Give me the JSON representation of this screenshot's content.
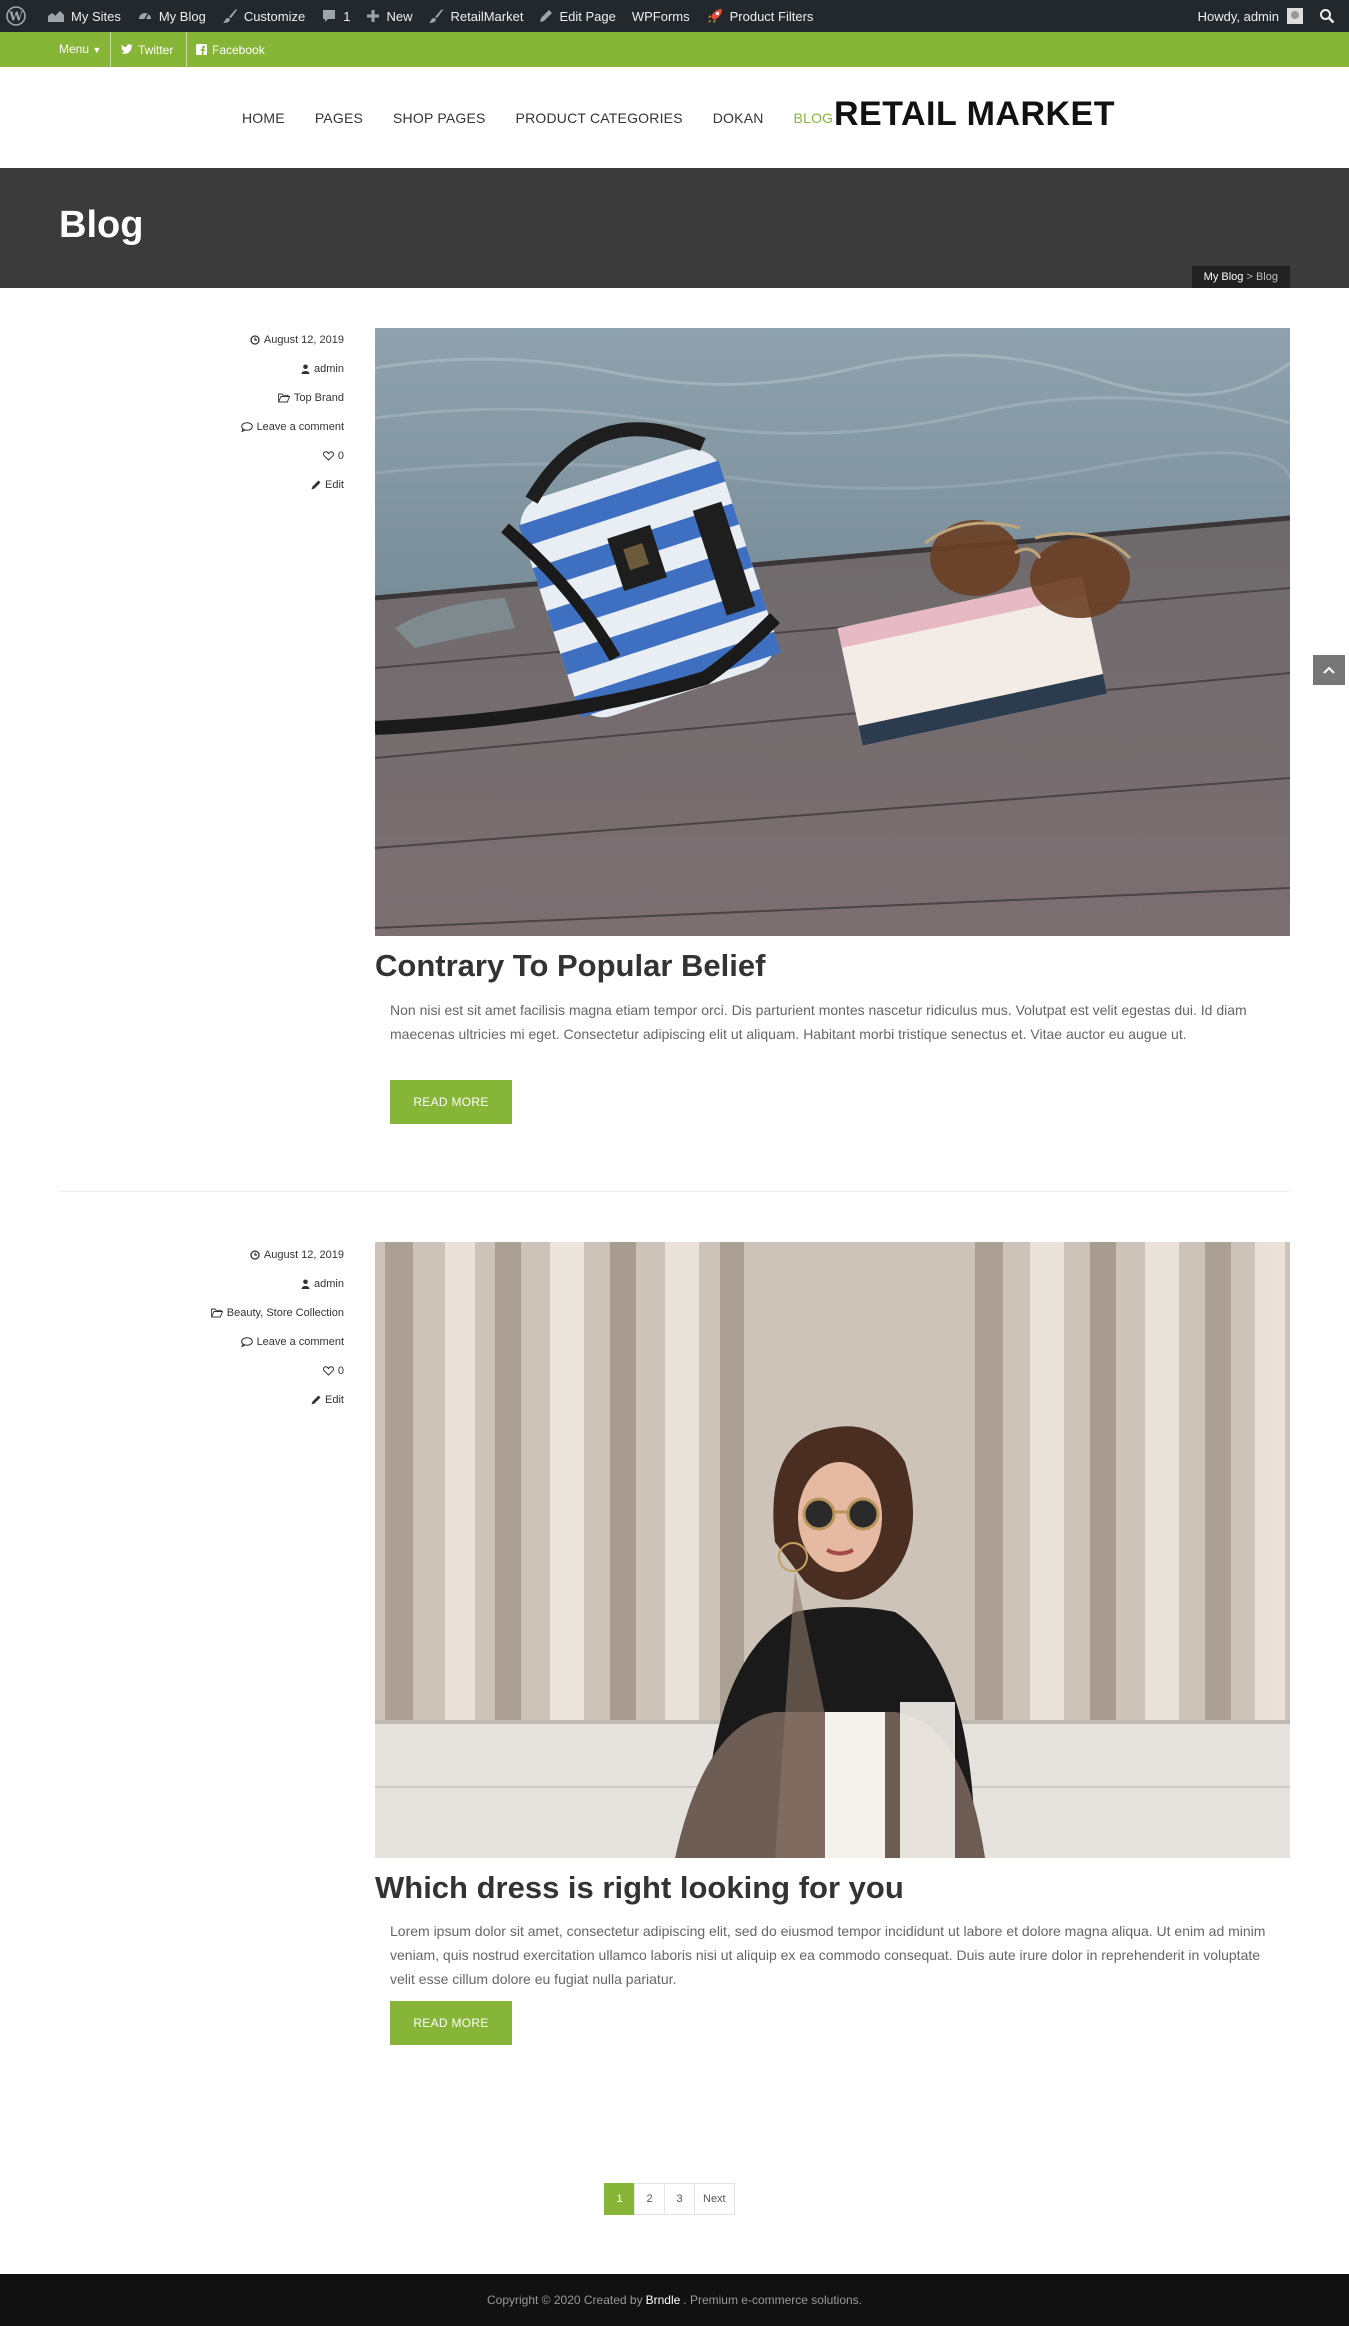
{
  "admin_bar": {
    "items": [
      {
        "label": "My Sites",
        "icon": "sites-icon"
      },
      {
        "label": "My Blog",
        "icon": "dashboard-icon"
      },
      {
        "label": "Customize",
        "icon": "brush-icon"
      },
      {
        "label": "1",
        "icon": "comment-icon"
      },
      {
        "label": "New",
        "icon": "plus-icon"
      },
      {
        "label": "RetailMarket",
        "icon": "brush-icon"
      },
      {
        "label": "Edit Page",
        "icon": "pencil-icon"
      },
      {
        "label": "WPForms",
        "icon": ""
      },
      {
        "label": "Product Filters",
        "icon": "rocket-icon"
      }
    ],
    "greeting": "Howdy, admin"
  },
  "top_bar": {
    "menu_label": "Menu",
    "twitter": "Twitter",
    "facebook": "Facebook"
  },
  "nav": {
    "items": [
      "HOME",
      "PAGES",
      "SHOP PAGES",
      "PRODUCT CATEGORIES",
      "DOKAN",
      "BLOG"
    ],
    "active": "BLOG"
  },
  "site": {
    "title": "RETAIL MARKET"
  },
  "page": {
    "title": "Blog",
    "breadcrumb_home": "My Blog",
    "breadcrumb_sep": " > ",
    "breadcrumb_current": "Blog"
  },
  "posts": [
    {
      "date": "August 12, 2019",
      "author": "admin",
      "categories": "Top Brand",
      "comments": "Leave a comment",
      "likes": "0",
      "edit": "Edit",
      "title": "Contrary To Popular Belief",
      "excerpt": "Non nisi est sit amet facilisis magna etiam tempor orci. Dis parturient montes nascetur ridiculus mus. Volutpat est velit egestas dui. Id diam maecenas ultricies mi eget. Consectetur adipiscing elit ut aliquam. Habitant morbi tristique senectus et. Vitae auctor eu augue ut.",
      "read_more": "READ MORE"
    },
    {
      "date": "August 12, 2019",
      "author": "admin",
      "categories": "Beauty, Store Collection",
      "comments": "Leave a comment",
      "likes": "0",
      "edit": "Edit",
      "title": "Which dress is right looking for you",
      "excerpt": "Lorem ipsum dolor sit amet, consectetur adipiscing elit, sed do eiusmod tempor incididunt ut labore et dolore magna aliqua. Ut enim ad minim veniam, quis nostrud exercitation ullamco laboris nisi ut aliquip ex ea commodo consequat. Duis aute irure dolor in reprehenderit in voluptate velit esse cillum dolore eu fugiat nulla pariatur.",
      "read_more": "READ MORE"
    }
  ],
  "pagination": {
    "pages": [
      "1",
      "2",
      "3"
    ],
    "current": "1",
    "next": "Next"
  },
  "footer": {
    "prefix": "Copyright © 2020 Created by",
    "brand": "Brndle",
    "suffix": ". Premium e-commerce solutions."
  },
  "colors": {
    "accent": "#86b537",
    "admin_bar": "#23282d",
    "banner": "#3b3b3b",
    "footer": "#111111"
  }
}
